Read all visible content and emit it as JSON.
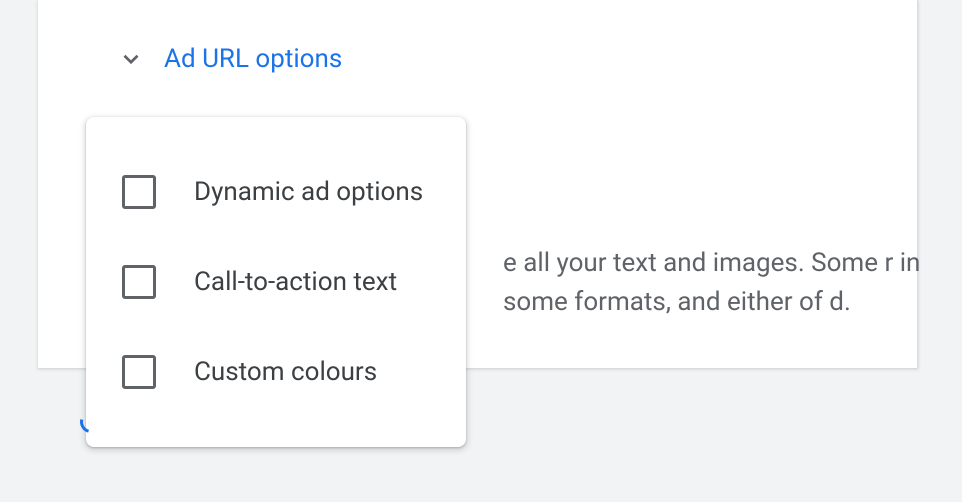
{
  "expand": {
    "label": "Ad URL options"
  },
  "background_text": "e all your text and images. Some r in some formats, and either of d.",
  "popup": {
    "items": [
      {
        "label": "Dynamic ad options"
      },
      {
        "label": "Call-to-action text"
      },
      {
        "label": "Custom colours"
      }
    ]
  }
}
